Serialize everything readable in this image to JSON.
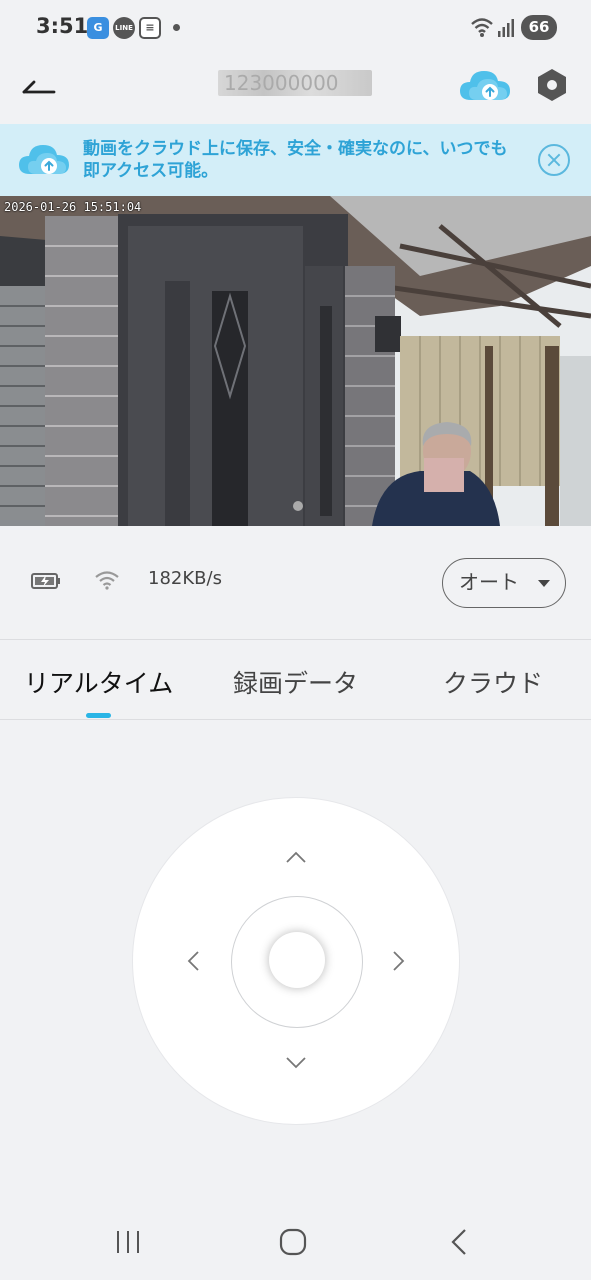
{
  "status_bar": {
    "time": "3:51",
    "battery": "66",
    "app_icons": [
      "app-g-icon",
      "line-icon",
      "news-icon"
    ]
  },
  "header": {
    "device_name": "123000000",
    "cloud_icon": "cloud-upload-icon",
    "settings_icon": "hexagon-settings-icon"
  },
  "banner": {
    "text": "動画をクラウド上に保存、安全・確実なのに、いつでも即アクセス可能。"
  },
  "video": {
    "timestamp": "2026-01-26 15:51:04"
  },
  "info": {
    "speed": "182KB/s",
    "quality": "オート"
  },
  "tabs": [
    {
      "label": "リアルタイム",
      "active": true
    },
    {
      "label": "録画データ",
      "active": false
    },
    {
      "label": "クラウド",
      "active": false
    }
  ],
  "colors": {
    "accent": "#2ab5e6",
    "banner_bg": "#d3eef8",
    "banner_text": "#2ea3d6",
    "background": "#f1f2f4"
  }
}
